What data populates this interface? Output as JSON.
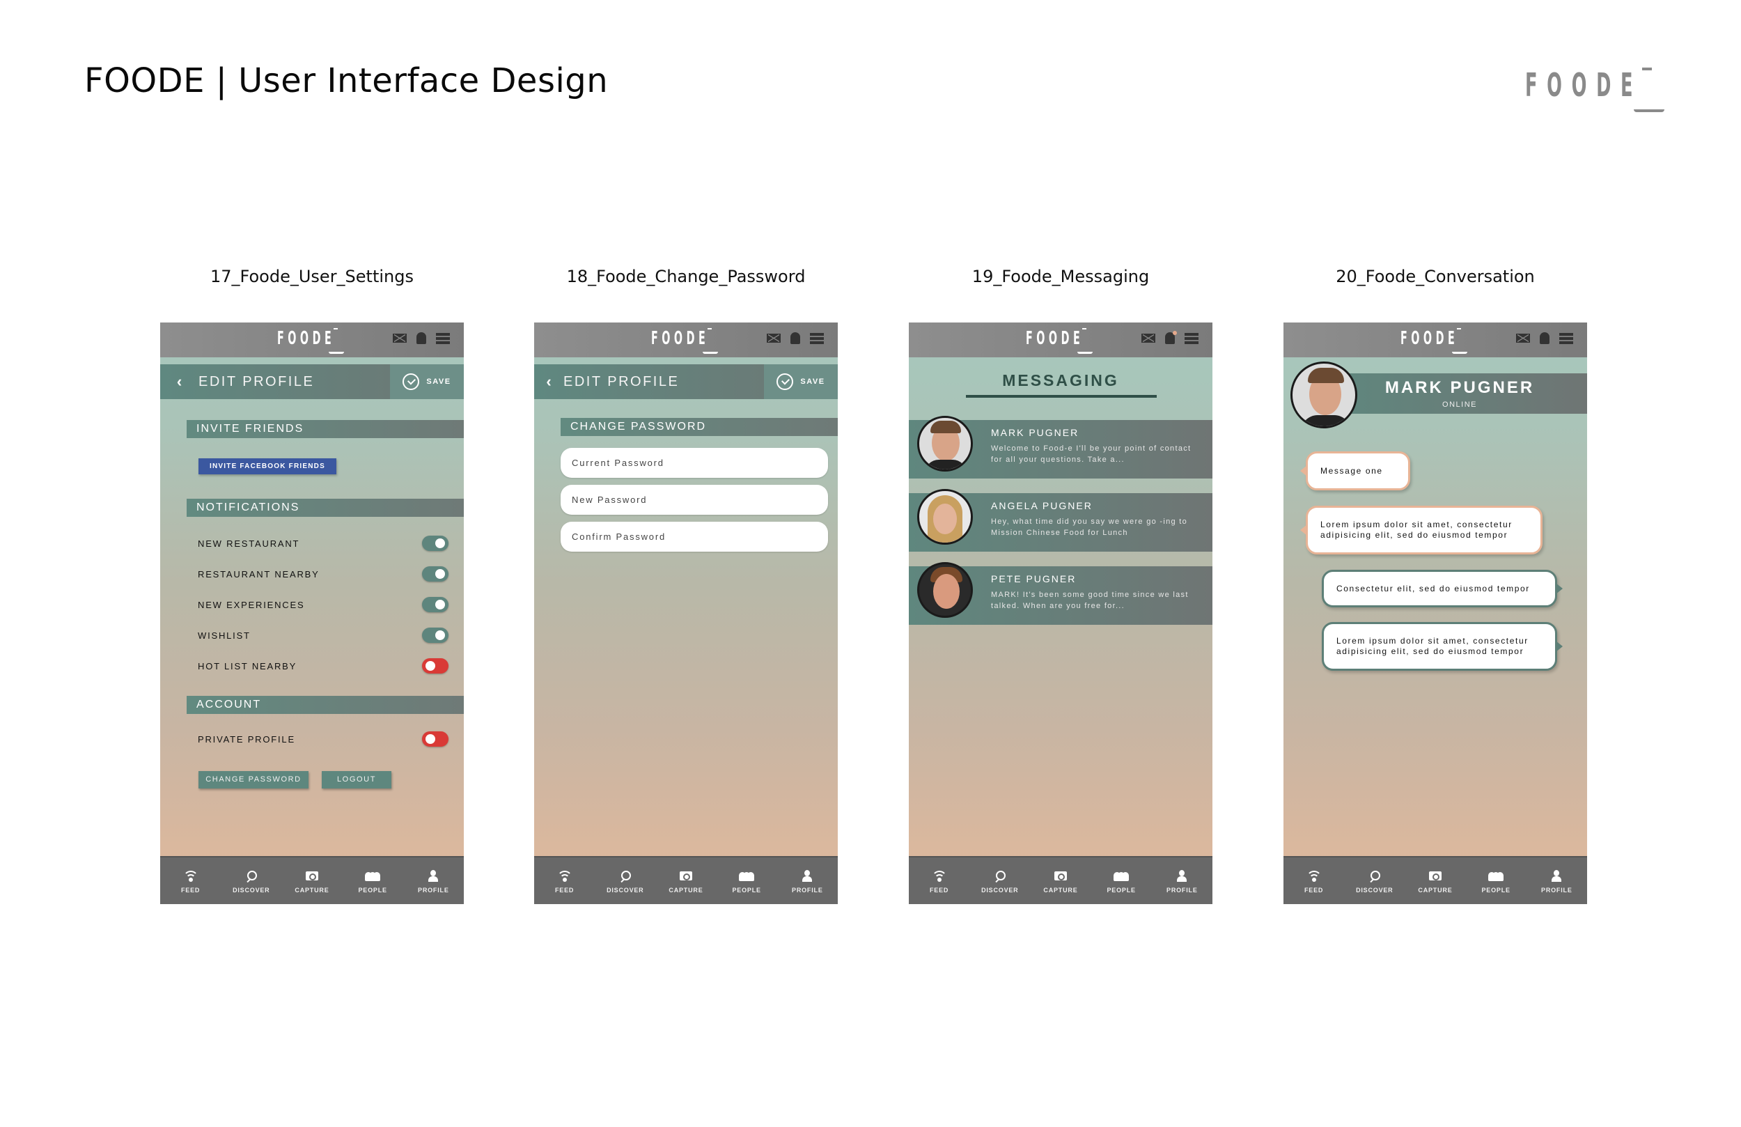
{
  "page": {
    "title": "FOODE  |  User Interface Design",
    "brand_logo": "FOODĒ"
  },
  "app": {
    "logo": "FOODE",
    "header_icons": [
      "mail-icon",
      "bell-icon",
      "menu-icon"
    ],
    "nav": [
      {
        "label": "FEED",
        "icon": "wifi-icon"
      },
      {
        "label": "DISCOVER",
        "icon": "search-icon"
      },
      {
        "label": "CAPTURE",
        "icon": "camera-icon"
      },
      {
        "label": "PEOPLE",
        "icon": "people-icon"
      },
      {
        "label": "PROFILE",
        "icon": "user-icon"
      }
    ]
  },
  "screens": [
    {
      "label": "17_Foode_User_Settings",
      "edit_title": "EDIT PROFILE",
      "save_label": "SAVE",
      "sections": {
        "invite": "INVITE FRIENDS",
        "notifications": "NOTIFICATIONS",
        "account": "ACCOUNT"
      },
      "invite_button": "INVITE FACEBOOK FRIENDS",
      "notifications": [
        {
          "label": "NEW RESTAURANT",
          "on": true
        },
        {
          "label": "RESTAURANT NEARBY",
          "on": true
        },
        {
          "label": "NEW EXPERIENCES",
          "on": true
        },
        {
          "label": "WISHLIST",
          "on": true
        },
        {
          "label": "HOT LIST NEARBY",
          "on": false
        }
      ],
      "account": [
        {
          "label": "PRIVATE PROFILE",
          "on": false
        }
      ],
      "buttons": {
        "change_password": "CHANGE PASSWORD",
        "logout": "LOGOUT"
      }
    },
    {
      "label": "18_Foode_Change_Password",
      "edit_title": "EDIT PROFILE",
      "save_label": "SAVE",
      "section": "CHANGE PASSWORD",
      "fields": [
        {
          "placeholder": "Current Password",
          "value": ""
        },
        {
          "placeholder": "New Password",
          "value": ""
        },
        {
          "placeholder": "Confirm Password",
          "value": ""
        }
      ]
    },
    {
      "label": "19_Foode_Messaging",
      "title": "MESSAGING",
      "conversations": [
        {
          "name": "MARK PUGNER",
          "preview": "Welcome to Food-e I'll be your point of contact for all your questions. Take a..."
        },
        {
          "name": "ANGELA PUGNER",
          "preview": "Hey, what time did you say we were go -ing to Mission Chinese Food for Lunch"
        },
        {
          "name": "PETE PUGNER",
          "preview": "MARK! It's been some good time since we last talked. When are you free for..."
        }
      ]
    },
    {
      "label": "20_Foode_Conversation",
      "contact_name": "MARK PUGNER",
      "contact_status": "ONLINE",
      "messages": [
        {
          "direction": "incoming",
          "text": "Message one"
        },
        {
          "direction": "incoming",
          "text": "Lorem ipsum dolor sit amet, consectetur adipisicing elit, sed do eiusmod tempor"
        },
        {
          "direction": "outgoing",
          "text": "Consectetur elit, sed do eiusmod tempor"
        },
        {
          "direction": "outgoing",
          "text": "Lorem ipsum dolor sit amet, consectetur adipisicing elit, sed do eiusmod tempor"
        }
      ]
    }
  ],
  "colors": {
    "teal": "#5e857d",
    "toggle_off": "#d93a36",
    "facebook": "#3b58a0",
    "nav_bg": "#686868",
    "header_bg": "#8a8a8a",
    "bubble_in_border": "#e8b496",
    "bubble_out_border": "#5d7f77"
  }
}
